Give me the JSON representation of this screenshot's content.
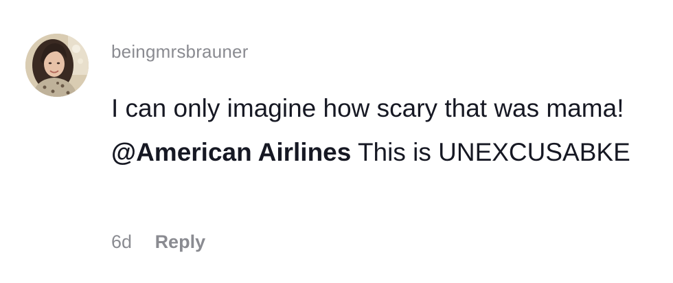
{
  "comment": {
    "username": "beingmrsbrauner",
    "text_part1": "I can only imagine how scary that was mama! ",
    "mention": "@American Airlines",
    "text_part2": " This is UNEXCUSABKE",
    "time": "6d",
    "reply_label": "Reply"
  },
  "avatar": {
    "icon": "user-avatar-photo"
  }
}
